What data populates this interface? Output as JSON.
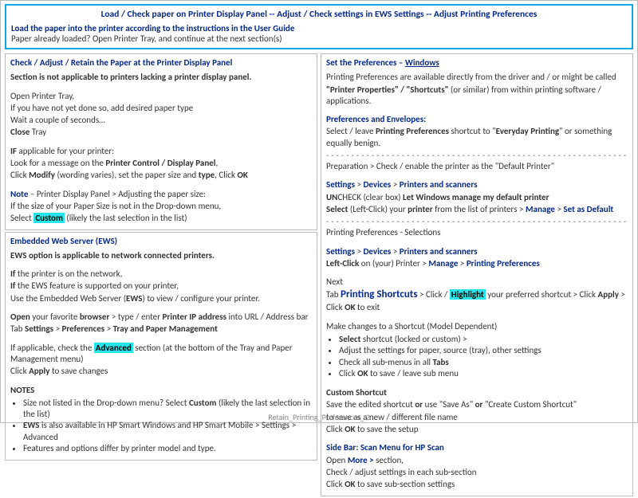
{
  "banner": {
    "title": "Load / Check paper on Printer Display Panel -- Adjust / Check settings in EWS Settings -- Adjust Printing Preferences",
    "line1": "Load the paper into the printer according to the instructions in the User Guide",
    "line2": "Paper already loaded?  Open Printer Tray, and continue at the next section(s)"
  },
  "left1": {
    "title": "Check / Adjust / Retain the Paper at the Printer Display Panel",
    "p1": "Section is not applicable to printers lacking a printer display panel.",
    "p2": "Open Printer Tray,",
    "p3": "If you have not yet done so, add desired paper type",
    "p4": "Wait a couple of seconds…",
    "p5a": "Close",
    "p5b": " Tray",
    "p6a": "IF",
    "p6b": " applicable for your printer:",
    "p7a": "Look for a message on the ",
    "p7b": "Printer Control / Display Panel",
    "p7c": ",",
    "p8a": "Click ",
    "p8b": "Modify",
    "p8c": " (wording varies), set the paper size and ",
    "p8d": "type",
    "p8e": ", Click ",
    "p8f": "OK",
    "p9a": "Note",
    "p9b": "  – Printer Display Panel > Adjusting the paper size:",
    "p10": "If the size of your Paper Size is not in the Drop-down menu,",
    "p11a": "Select ",
    "p11b": "Custom",
    "p11c": " (likely the last selection in the list)"
  },
  "left2": {
    "title": "Embedded Web Server (EWS)",
    "p1": "EWS option is applicable to network connected printers.",
    "p2a": "If",
    "p2b": " the printer is on the network,",
    "p3a": "If",
    "p3b": " the EWS feature is supported on your printer,",
    "p4a": "Use the Embedded Web Server (",
    "p4b": "EWS",
    "p4c": ") to view / configure your printer.",
    "p5a": "Open",
    "p5b": " your favorite ",
    "p5c": "browser",
    "p5d": " > type / enter ",
    "p5e": "Printer IP address",
    "p5f": " into URL / Address bar",
    "p6a": "Tab ",
    "p6b": "Settings",
    "p6c": " > ",
    "p6d": "Preferences",
    "p6e": " > ",
    "p6f": "Tray and Paper Management",
    "p7a": "If applicable, check the ",
    "p7b": "Advanced",
    "p7c": " section (at the bottom of the Tray and Paper Management menu)",
    "p8a": "Click ",
    "p8b": "Apply",
    "p8c": " to save changes",
    "notes": "NOTES",
    "b1a": "Size not listed in the Drop-down menu?  Select ",
    "b1b": "Custom",
    "b1c": " (likely the last selection in the list)",
    "b2a": "EWS",
    "b2b": " is also available in HP Smart Windows and HP Smart Mobile > Settings > Advanced",
    "b3": "Features and options differ by printer model and type."
  },
  "right": {
    "title_a": "Set the Preferences – ",
    "title_b": "Windows",
    "p1a": "Printing Preferences are available directly from the driver and / or might be called",
    "p1b": "\"Printer Properties\" / \"Shortcuts\"",
    "p1c": " (or similar) from within printing software / applications.",
    "p2a": "Preferences and ",
    "p2b": "Envelopes",
    "p2c": ":",
    "p3a": "Select / leave ",
    "p3b": "Printing Preferences",
    "p3c": " shortcut to \"",
    "p3d": "Everyday Printing",
    "p3e": "\" or something equally benign.",
    "sep": "- - - - - - - - - - - - - - - - - - - - - - - - - - - - - - - - - - - - - - - - - - - - - - - - - - - - - - - - - - - - - -",
    "p4": "Preparation > Check / enable the printer as the \"Default Printer\"",
    "p5a": "Settings",
    "p5b": " > ",
    "p5c": "Devices",
    "p5d": " > ",
    "p5e": "Printers and scanners",
    "p6a": "UN",
    "p6b": "CHECK (clear box) ",
    "p6c": "Let Windows manage my default printer",
    "p7a": "Select",
    "p7b": " (Left-Click) your ",
    "p7c": "printer",
    "p7d": " from the list of printers > ",
    "p7e": "Manage",
    "p7f": " > ",
    "p7g": "Set as Default",
    "p8": "Printing Preferences - Selections",
    "p9a": "Settings",
    "p9b": " > ",
    "p9c": "Devices",
    "p9d": " > ",
    "p9e": "Printers and scanners",
    "p10a": "Left-Click",
    "p10b": " on (your) Printer > ",
    "p10c": "Manage",
    "p10d": " > ",
    "p10e": "Printing Preferences",
    "p11": "Next",
    "p12a": "Tab ",
    "p12b": "Printing Shortcuts",
    "p12c": " > Click / ",
    "p12d": "Highlight",
    "p12e": " your preferred shortcut > Click ",
    "p12f": "Apply",
    "p12g": " > Click ",
    "p12h": "OK",
    "p12i": " to exit",
    "p13": "Make changes to a Shortcut (Model Dependent)",
    "b1a": "Select",
    "b1b": " shortcut (locked or custom) >",
    "b2": "Adjust the settings for paper, source (tray), other settings",
    "b3a": "Check all sub-menus in all ",
    "b3b": "Tabs",
    "b4a": "Click ",
    "b4b": "OK",
    "b4c": " to save / leave sub menu",
    "p14": "Custom Shortcut",
    "p15a": "Save the edited shortcut ",
    "p15b": "or",
    "p15c": " use \"Save As\" ",
    "p15d": "or",
    "p15e": " \"Create Custom Shortcut\"",
    "p16": "to save as a new / different file name",
    "p17a": "Click ",
    "p17b": "OK",
    "p17c": " to save the setup",
    "p18a": "Side Bar:  Scan Menu for ",
    "p18b": "HP Scan",
    "p19a": "Open ",
    "p19b": "More >",
    "p19c": " section,",
    "p20": "Check / adjust settings in each sub-section",
    "p21a": "Click ",
    "p21b": "OK",
    "p21c": " to save sub-section settings"
  },
  "footer": "Retain_Printing_Preferences_ 2"
}
